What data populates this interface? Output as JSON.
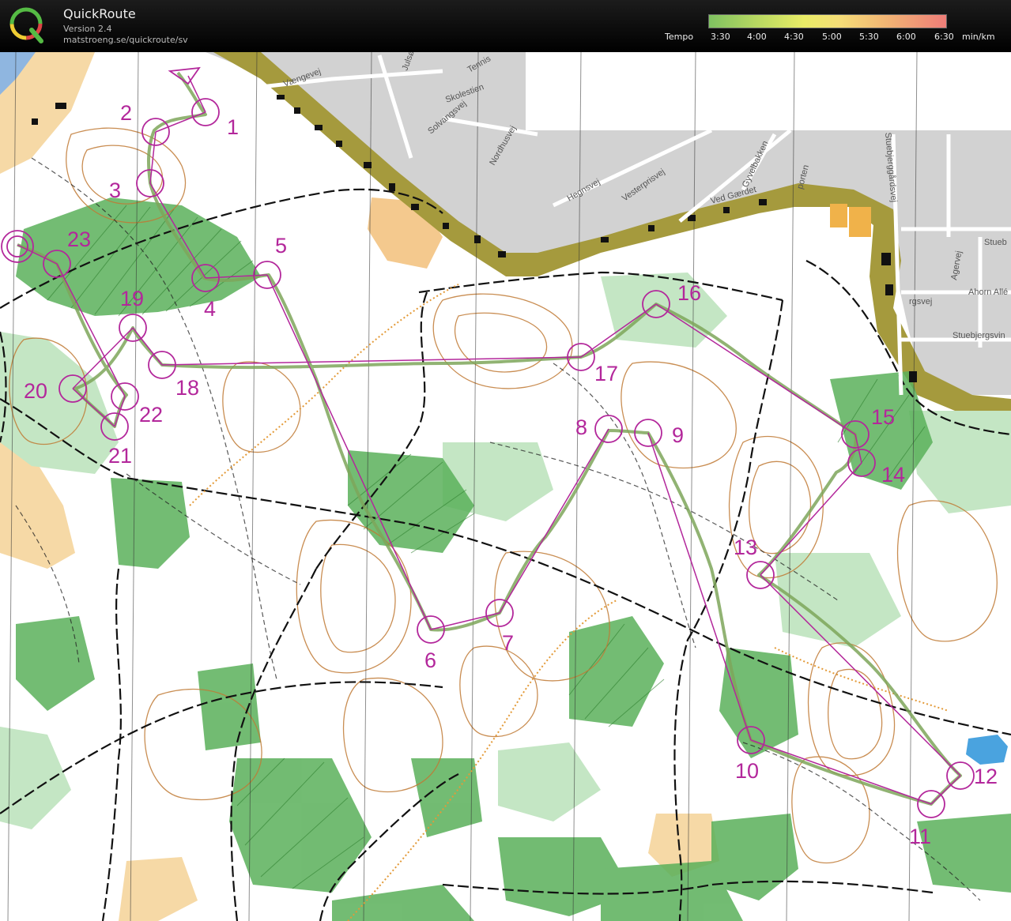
{
  "app": {
    "title": "QuickRoute",
    "version": "Version 2.4",
    "url": "matstroeng.se/quickroute/sv",
    "logo_letter": "Q"
  },
  "tempo": {
    "label": "Tempo",
    "ticks": [
      "3:30",
      "4:00",
      "4:30",
      "5:00",
      "5:30",
      "6:00",
      "6:30"
    ],
    "unit": "min/km"
  },
  "streets": [
    "Vængevej",
    "Julsø",
    "Tennis",
    "Skolestien",
    "Solvangsvej",
    "Nordhusvej",
    "Hegnsvej",
    "Vesterprisvej",
    "Gyvelbakken",
    "Ved Gærdet",
    "porten",
    "Stuebjerggårdsvej",
    "Stueb",
    "Agervej",
    "Ahorn Allé",
    "rgsvej",
    "Stuebjergsvin"
  ],
  "controls": [
    "1",
    "2",
    "3",
    "4",
    "5",
    "6",
    "7",
    "8",
    "9",
    "10",
    "11",
    "12",
    "13",
    "14",
    "15",
    "16",
    "17",
    "18",
    "19",
    "20",
    "21",
    "22",
    "23"
  ],
  "colors": {
    "course": "#b3279b",
    "route": "#7ea65a",
    "forest": "#3d9b3d",
    "light_green": "#9ed49e",
    "contour": "#b86b1f",
    "open_land": "#f3c98a",
    "urban": "#cfcfcf"
  }
}
